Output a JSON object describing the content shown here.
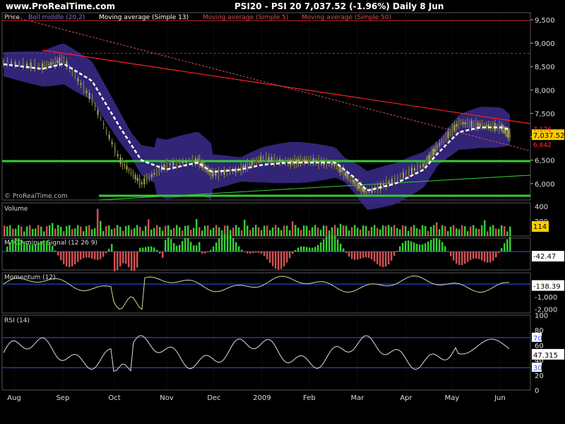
{
  "header": {
    "site": "www.ProRealTime.com",
    "symbol_line": "PSI20 - PSI 20    7,037.52  (-1.96%)    Daily  8 Jun"
  },
  "watermark": "© ProRealTime.com",
  "colors": {
    "background": "#000000",
    "price": "#8f8f3f",
    "band": "#3b2a8c",
    "ma13": "#ffffff",
    "ma5": "#d05050",
    "ma50": "#d05050",
    "trendline": "#ff2020",
    "support": "#33cc33",
    "resistance": "#cc2020",
    "vol_up": "#33cc33",
    "vol_down": "#d05050"
  },
  "x_axis_labels": [
    "Aug",
    "Sep",
    "Oct",
    "Nov",
    "Dec",
    "2009",
    "Feb",
    "Mar",
    "Apr",
    "May",
    "Jun"
  ],
  "chart_data": [
    {
      "type": "line",
      "panel": "price",
      "legend": [
        "Price",
        "Boll middle (20,2)",
        "Moving average (Simple 13)",
        "Moving average (Simple 5)",
        "Moving average (Simple 50)"
      ],
      "y_ticks": [
        "9,500",
        "9,000",
        "8,500",
        "8,000",
        "7,500",
        "7,000",
        "6,500",
        "6,000"
      ],
      "ylim": [
        5650,
        9650
      ],
      "last_value": "7,037.52",
      "right_labels": [
        "7,176",
        "6,842"
      ],
      "x": [
        "Jul 25",
        "Aug 15",
        "Sep 5",
        "Sep 26",
        "Oct 8",
        "Oct 20",
        "Nov 1",
        "Nov 15",
        "Dec 1",
        "Dec 15",
        "Jan 1",
        "Jan 15",
        "Feb 1",
        "Feb 15",
        "Mar 1",
        "Mar 10",
        "Mar 25",
        "Apr 10",
        "Apr 25",
        "May 5",
        "May 20",
        "Jun 1",
        "Jun 8"
      ],
      "series": [
        {
          "name": "Price",
          "values": [
            8600,
            8500,
            8650,
            7800,
            6500,
            6000,
            6400,
            6500,
            6200,
            6300,
            6550,
            6450,
            6500,
            6400,
            6050,
            5800,
            6100,
            6400,
            6800,
            7300,
            7250,
            7200,
            7037
          ]
        },
        {
          "name": "Moving average (Simple 13)",
          "values": [
            8550,
            8450,
            8560,
            8200,
            7200,
            6500,
            6300,
            6450,
            6250,
            6300,
            6400,
            6450,
            6450,
            6450,
            6150,
            5850,
            6000,
            6300,
            6650,
            7100,
            7200,
            7200,
            7150
          ]
        }
      ],
      "horizontal_lines": {
        "green": [
          6480,
          5740
        ],
        "red_dashed": [
          8780
        ],
        "red": [
          9480
        ]
      }
    },
    {
      "type": "bar",
      "panel": "volume",
      "legend": [
        "Volume"
      ],
      "y_ticks": [
        "400",
        "200"
      ],
      "ylim": [
        0,
        450
      ],
      "last_value": "114"
    },
    {
      "type": "bar",
      "panel": "macd",
      "legend": [
        "MACD minus Signal (12 26 9)"
      ],
      "y_ticks": [],
      "ylim": [
        -60,
        60
      ],
      "last_value": "-42.47"
    },
    {
      "type": "area",
      "panel": "momentum",
      "legend": [
        "Momentum (12)"
      ],
      "y_ticks": [
        "0",
        "-1,000",
        "-2,000"
      ],
      "ylim": [
        -2300,
        900
      ],
      "last_value": "-138.39"
    },
    {
      "type": "line",
      "panel": "rsi",
      "legend": [
        "RSI (14)"
      ],
      "y_ticks": [
        "100",
        "80",
        "60",
        "40",
        "20",
        "0"
      ],
      "ylim": [
        0,
        100
      ],
      "levels": [
        "70",
        "30"
      ],
      "last_value": "47.315"
    }
  ]
}
